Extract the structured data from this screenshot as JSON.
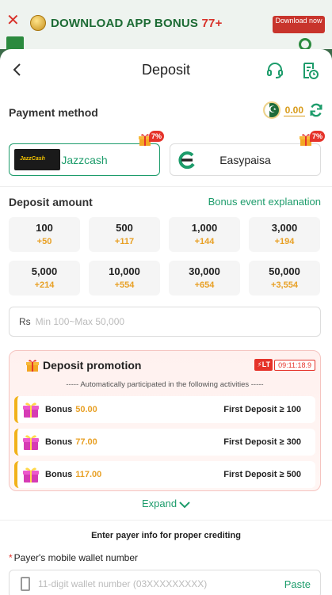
{
  "banner": {
    "close": "✕",
    "text": "DOWNLOAD APP BONUS",
    "highlight": "77+",
    "download_btn": "Download now"
  },
  "header": {
    "title": "Deposit"
  },
  "payment": {
    "label": "Payment method",
    "balance": "0.00",
    "methods": [
      {
        "name": "Jazzcash",
        "logo_text": "JazzCash",
        "badge": "7%",
        "selected": true
      },
      {
        "name": "Easypaisa",
        "badge": "7%",
        "selected": false
      }
    ]
  },
  "deposit": {
    "label": "Deposit amount",
    "bonus_link": "Bonus event explanation",
    "amounts": [
      {
        "value": "100",
        "bonus": "+50"
      },
      {
        "value": "500",
        "bonus": "+117"
      },
      {
        "value": "1,000",
        "bonus": "+144"
      },
      {
        "value": "3,000",
        "bonus": "+194"
      },
      {
        "value": "5,000",
        "bonus": "+214"
      },
      {
        "value": "10,000",
        "bonus": "+554"
      },
      {
        "value": "30,000",
        "bonus": "+654"
      },
      {
        "value": "50,000",
        "bonus": "+3,554"
      }
    ],
    "currency": "Rs",
    "placeholder": "Min 100~Max 50,000"
  },
  "promotion": {
    "title": "Deposit promotion",
    "lt": "LT",
    "timer": "09:11:18.9",
    "subtitle": "----- Automatically participated in the following activities -----",
    "items": [
      {
        "label": "Bonus",
        "value": "50.00",
        "condition": "First Deposit ≥ 100"
      },
      {
        "label": "Bonus",
        "value": "77.00",
        "condition": "First Deposit ≥ 300"
      },
      {
        "label": "Bonus",
        "value": "117.00",
        "condition": "First Deposit ≥ 500"
      }
    ],
    "expand": "Expand"
  },
  "payer": {
    "title": "Enter payer info for proper crediting",
    "required_mark": "*",
    "field_label": "Payer's mobile wallet number",
    "placeholder": "11-digit wallet number (03XXXXXXXXX)",
    "paste": "Paste"
  },
  "colors": {
    "accent": "#1d9c6b",
    "bonus": "#e8a025",
    "alert": "#e5332a"
  }
}
